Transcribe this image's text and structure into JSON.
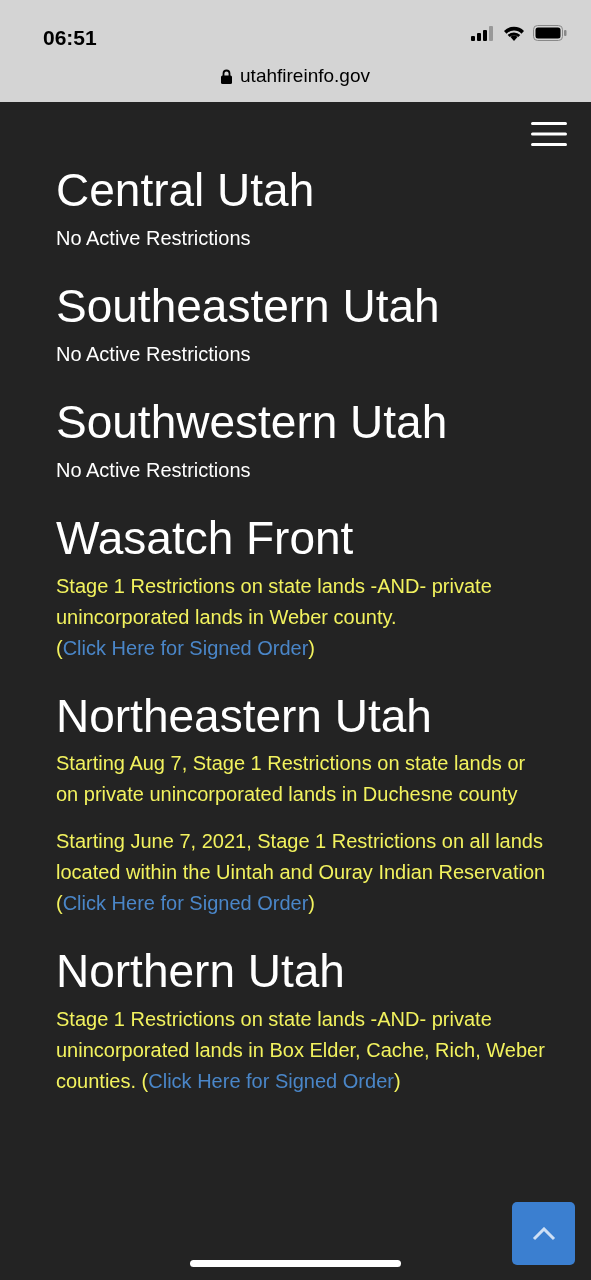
{
  "status_bar": {
    "time": "06:51",
    "url": "utahfireinfo.gov"
  },
  "regions": [
    {
      "title": "Central Utah",
      "notices": [
        {
          "kind": "none",
          "text": "No Active Restrictions"
        }
      ]
    },
    {
      "title": "Southeastern Utah",
      "notices": [
        {
          "kind": "none",
          "text": "No Active Restrictions"
        }
      ]
    },
    {
      "title": "Southwestern Utah",
      "notices": [
        {
          "kind": "none",
          "text": "No Active Restrictions"
        }
      ]
    },
    {
      "title": "Wasatch Front",
      "notices": [
        {
          "kind": "active",
          "text": "Stage 1 Restrictions on state lands -AND- private unincorporated lands in Weber county. (",
          "link": "Click Here for Signed Order",
          "after": ")"
        }
      ]
    },
    {
      "title": "Northeastern Utah",
      "notices": [
        {
          "kind": "active",
          "text": "Starting Aug 7, Stage 1 Restrictions on state lands or on private unincorporated lands in Duchesne county"
        },
        {
          "kind": "active",
          "text": "Starting June 7, 2021, Stage 1 Restrictions on all lands located within the Uintah and Ouray Indian Reservation (",
          "link": "Click Here for Signed Order",
          "after": ")"
        }
      ]
    },
    {
      "title": "Northern Utah",
      "notices": [
        {
          "kind": "active",
          "text": "Stage 1 Restrictions on state lands -AND- private unincorporated lands in Box Elder, Cache, Rich, Weber counties. (",
          "link": "Click Here for Signed Order",
          "after": ")"
        }
      ]
    }
  ]
}
